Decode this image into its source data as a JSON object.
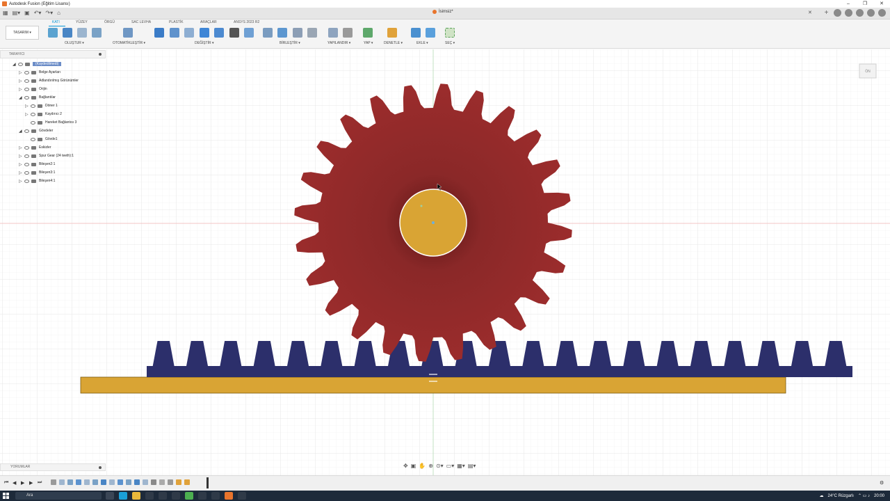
{
  "window": {
    "title": "Autodesk Fusion (Eğitim Lisansı)",
    "doc_tab": "İsimsiz*"
  },
  "toolbar": {
    "workspace": "TASARIM ▾",
    "tabs": [
      "KATI",
      "YÜZEY",
      "ÖRGÜ",
      "SAC LEVHA",
      "PLASTİK",
      "ARAÇLAR",
      "ANSYS 2023 R2"
    ],
    "active_tab": "KATI",
    "groups": [
      "OLUŞTUR ▾",
      "OTOMATİKLEŞTİR ▾",
      "DEĞİŞTİR ▾",
      "BİRLEŞTİR ▾",
      "YAPILANDIR ▾",
      "YAP ▾",
      "DENETLE ▾",
      "EKLE ▾",
      "SEÇ ▾"
    ]
  },
  "browser": {
    "header": "TARAYICI",
    "items": [
      {
        "label": "(Kaydedilmedi)",
        "depth": 0,
        "caret": "◢"
      },
      {
        "label": "Belge Ayarları",
        "depth": 1,
        "caret": "▷"
      },
      {
        "label": "Adlandırılmış Görünümler",
        "depth": 1,
        "caret": "▷"
      },
      {
        "label": "Orijin",
        "depth": 1,
        "caret": "▷"
      },
      {
        "label": "Bağlantılar",
        "depth": 1,
        "caret": "◢"
      },
      {
        "label": "Döner 1",
        "depth": 2,
        "caret": "▷"
      },
      {
        "label": "Kaydırıcı 2",
        "depth": 2,
        "caret": "▷"
      },
      {
        "label": "Hareket Bağlantısı 3",
        "depth": 2,
        "caret": ""
      },
      {
        "label": "Gövdeler",
        "depth": 1,
        "caret": "◢"
      },
      {
        "label": "Gövde1",
        "depth": 2,
        "caret": ""
      },
      {
        "label": "Eskizler",
        "depth": 1,
        "caret": "▷"
      },
      {
        "label": "Spur Gear (24 teeth):1",
        "depth": 1,
        "caret": "▷"
      },
      {
        "label": "Bileşen2:1",
        "depth": 1,
        "caret": "▷"
      },
      {
        "label": "Bileşen3:1",
        "depth": 1,
        "caret": "▷"
      },
      {
        "label": "Bileşen4:1",
        "depth": 1,
        "caret": "▷"
      }
    ]
  },
  "comments": {
    "header": "YORUMLAR"
  },
  "viewcube": {
    "label": "ÖN"
  },
  "viewport": {
    "gear_color": "#9b2c2c",
    "hub_color": "#d9a434",
    "rack_color": "#2c2f6b",
    "base_color": "#d9a434",
    "gear_teeth": 24,
    "rack_teeth": 21
  },
  "taskbar": {
    "search_placeholder": "Ara",
    "weather": "24°C Rüzgarlı",
    "time": "20:00"
  }
}
